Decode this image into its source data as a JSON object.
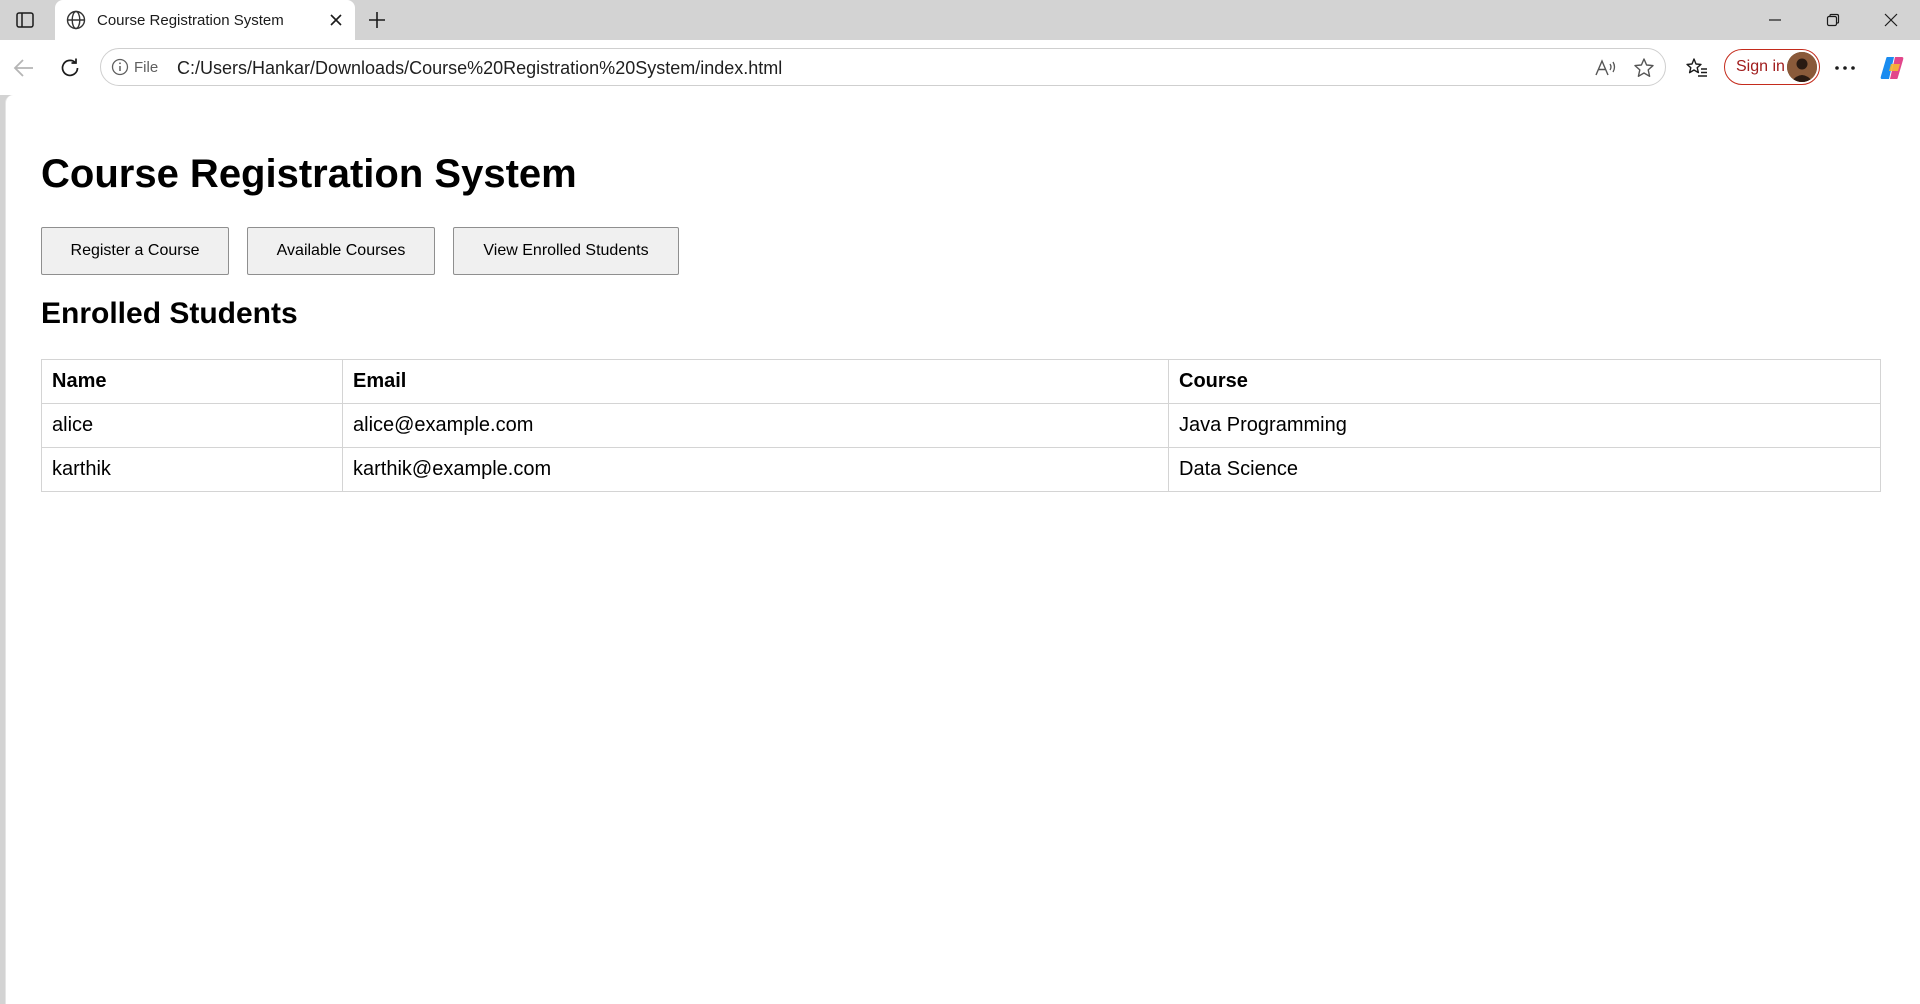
{
  "browser": {
    "tab": {
      "title": "Course Registration System"
    },
    "address": {
      "scheme_label": "File",
      "url": "C:/Users/Hankar/Downloads/Course%20Registration%20System/index.html"
    },
    "signin_label": "Sign in"
  },
  "page": {
    "title": "Course Registration System",
    "buttons": {
      "register": "Register a Course",
      "available": "Available Courses",
      "view_enrolled": "View Enrolled Students"
    },
    "section_title": "Enrolled Students",
    "table": {
      "headers": [
        "Name",
        "Email",
        "Course"
      ],
      "rows": [
        [
          "alice",
          "alice@example.com",
          "Java Programming"
        ],
        [
          "karthik",
          "karthik@example.com",
          "Data Science"
        ]
      ]
    }
  },
  "colors": {
    "signin_border": "#c42b1c",
    "button_bg": "#f0f0f0",
    "table_border": "#d4d4d4"
  }
}
